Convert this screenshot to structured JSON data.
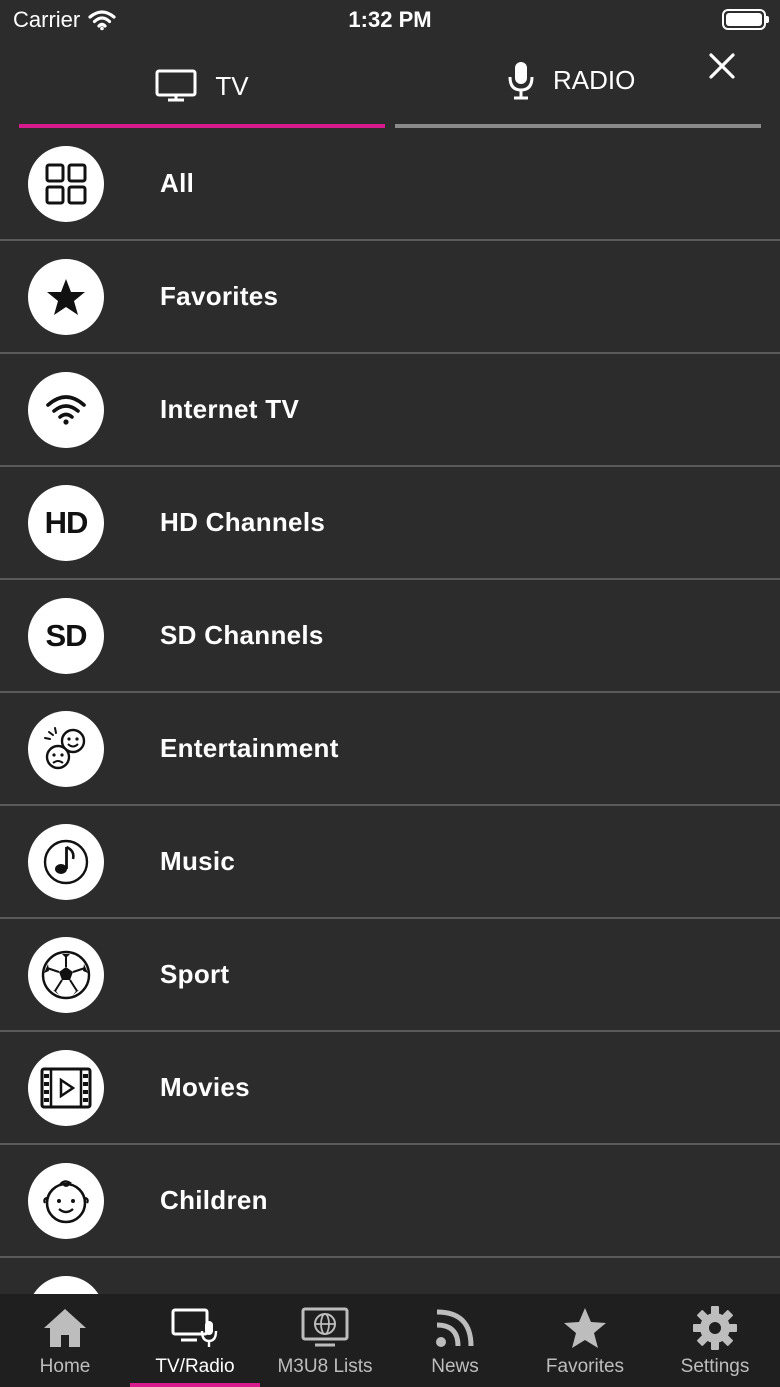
{
  "status": {
    "carrier": "Carrier",
    "time": "1:32 PM"
  },
  "tabs": {
    "tv": "TV",
    "radio": "RADIO"
  },
  "accent_color": "#d81b8c",
  "categories": [
    {
      "label": "All",
      "icon": "grid-icon"
    },
    {
      "label": "Favorites",
      "icon": "star-icon"
    },
    {
      "label": "Internet TV",
      "icon": "wifi-icon"
    },
    {
      "label": "HD Channels",
      "icon": "hd-icon",
      "badge": "HD"
    },
    {
      "label": "SD Channels",
      "icon": "sd-icon",
      "badge": "SD"
    },
    {
      "label": "Entertainment",
      "icon": "masks-icon"
    },
    {
      "label": "Music",
      "icon": "music-note-icon"
    },
    {
      "label": "Sport",
      "icon": "soccer-ball-icon"
    },
    {
      "label": "Movies",
      "icon": "film-icon"
    },
    {
      "label": "Children",
      "icon": "baby-face-icon"
    }
  ],
  "bottom_nav": [
    {
      "label": "Home",
      "icon": "home-icon"
    },
    {
      "label": "TV/Radio",
      "icon": "tv-radio-icon",
      "active": true
    },
    {
      "label": "M3U8 Lists",
      "icon": "globe-monitor-icon"
    },
    {
      "label": "News",
      "icon": "rss-icon"
    },
    {
      "label": "Favorites",
      "icon": "star-icon"
    },
    {
      "label": "Settings",
      "icon": "gear-icon"
    }
  ]
}
